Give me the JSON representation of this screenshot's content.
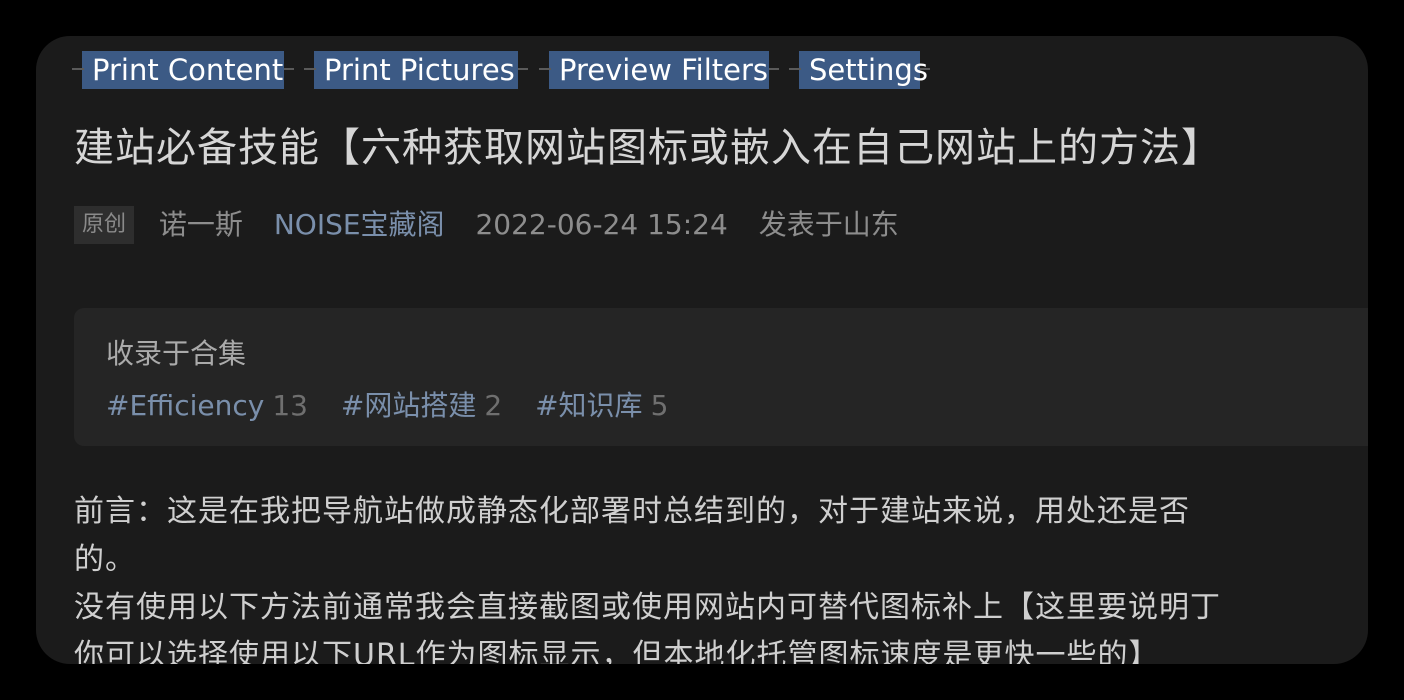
{
  "toolbar": {
    "print_content": "Print Content",
    "print_pictures": "Print Pictures",
    "preview_filters": "Preview Filters",
    "settings": "Settings"
  },
  "article": {
    "title": "建站必备技能【六种获取网站图标或嵌入在自己网站上的方法】",
    "meta": {
      "badge": "原创",
      "author": "诺一斯",
      "account": "NOISE宝藏阁",
      "date": "2022-06-24 15:24",
      "location": "发表于山东"
    },
    "collection": {
      "heading": "收录于合集",
      "tags": [
        {
          "name": "#Efficiency",
          "count": "13"
        },
        {
          "name": "#网站搭建",
          "count": "2"
        },
        {
          "name": "#知识库",
          "count": "5"
        }
      ]
    },
    "paragraphs": [
      "前言：这是在我把导航站做成静态化部署时总结到的，对于建站来说，用处还是否",
      "的。",
      "没有使用以下方法前通常我会直接截图或使用网站内可替代图标补上【这里要说明丁",
      "你可以选择使用以下URL作为图标显示，但本地化托管图标速度是更快一些的】"
    ]
  },
  "colors": {
    "background": "#000000",
    "window": "#1b1b1b",
    "card": "#252525",
    "toolbar_highlight": "#3c5a85",
    "link": "#7a8fab"
  }
}
